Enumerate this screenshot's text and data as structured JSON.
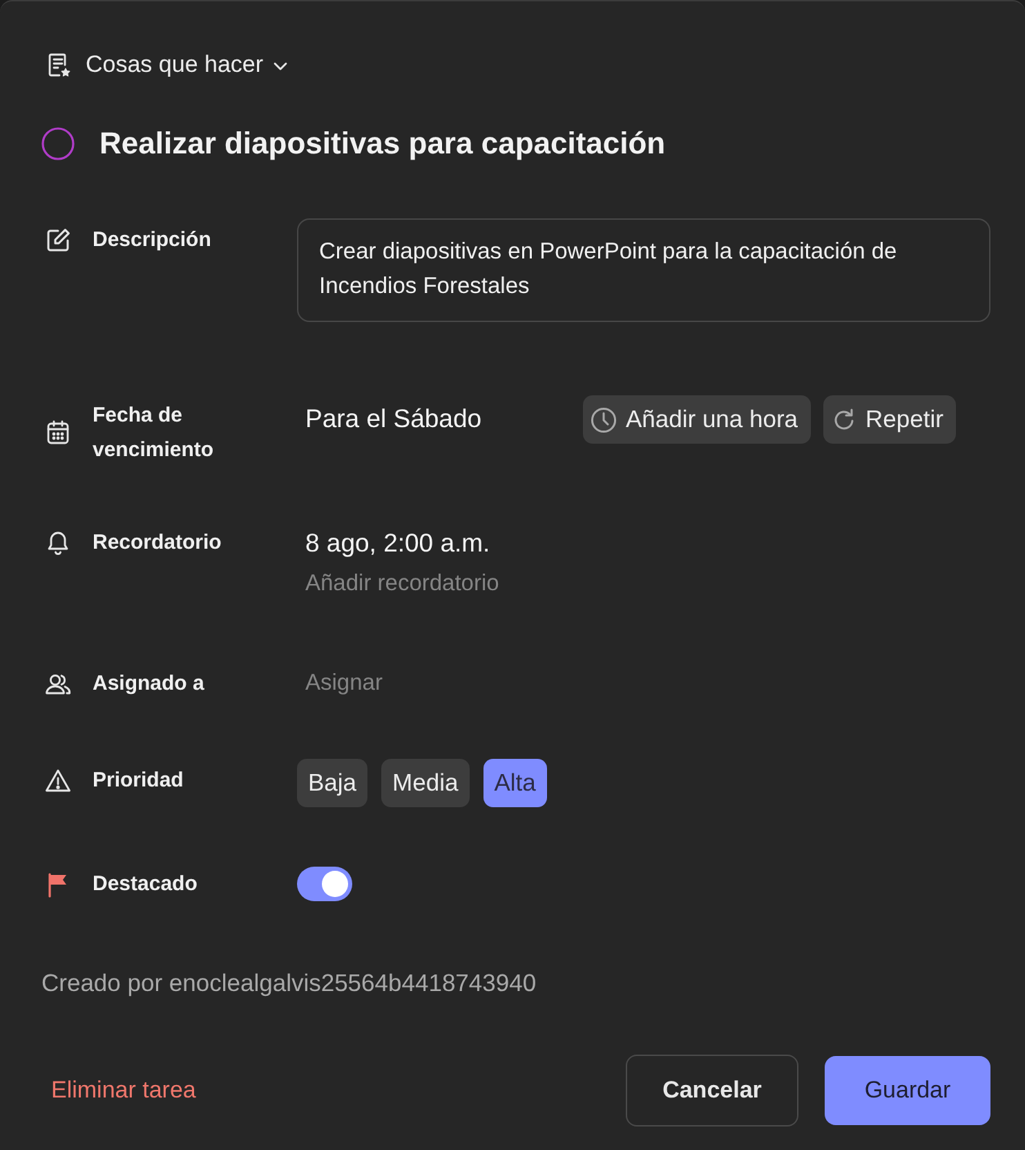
{
  "list_selector": {
    "label": "Cosas que hacer"
  },
  "task": {
    "title": "Realizar diapositivas para capacitación",
    "completed": false
  },
  "fields": [
    {
      "kind": "description",
      "label": "Descripción",
      "value": "Crear diapositivas en PowerPoint para la capacitación de Incendios Forestales"
    },
    {
      "kind": "due_date",
      "label": "Fecha de vencimiento",
      "value": "Para el Sábado",
      "actions": [
        {
          "kind": "time",
          "label": "Añadir una hora"
        },
        {
          "kind": "repeat",
          "label": "Repetir"
        }
      ]
    },
    {
      "kind": "reminder",
      "label": "Recordatorio",
      "value": "8 ago, 2:00 a.m.",
      "action": "Añadir recordatorio"
    },
    {
      "kind": "assignee",
      "label": "Asignado a",
      "action": "Asignar"
    },
    {
      "kind": "priority",
      "label": "Prioridad",
      "options": [
        {
          "label": "Baja",
          "selected": false
        },
        {
          "label": "Media",
          "selected": false
        },
        {
          "label": "Alta",
          "selected": true
        }
      ]
    },
    {
      "kind": "featured",
      "label": "Destacado",
      "on": true
    }
  ],
  "created_by": "Creado por enoclealgalvis25564b4418743940",
  "footer": {
    "delete": "Eliminar tarea",
    "buttons": [
      {
        "kind": "secondary",
        "label": "Cancelar"
      },
      {
        "kind": "primary",
        "label": "Guardar"
      }
    ]
  }
}
